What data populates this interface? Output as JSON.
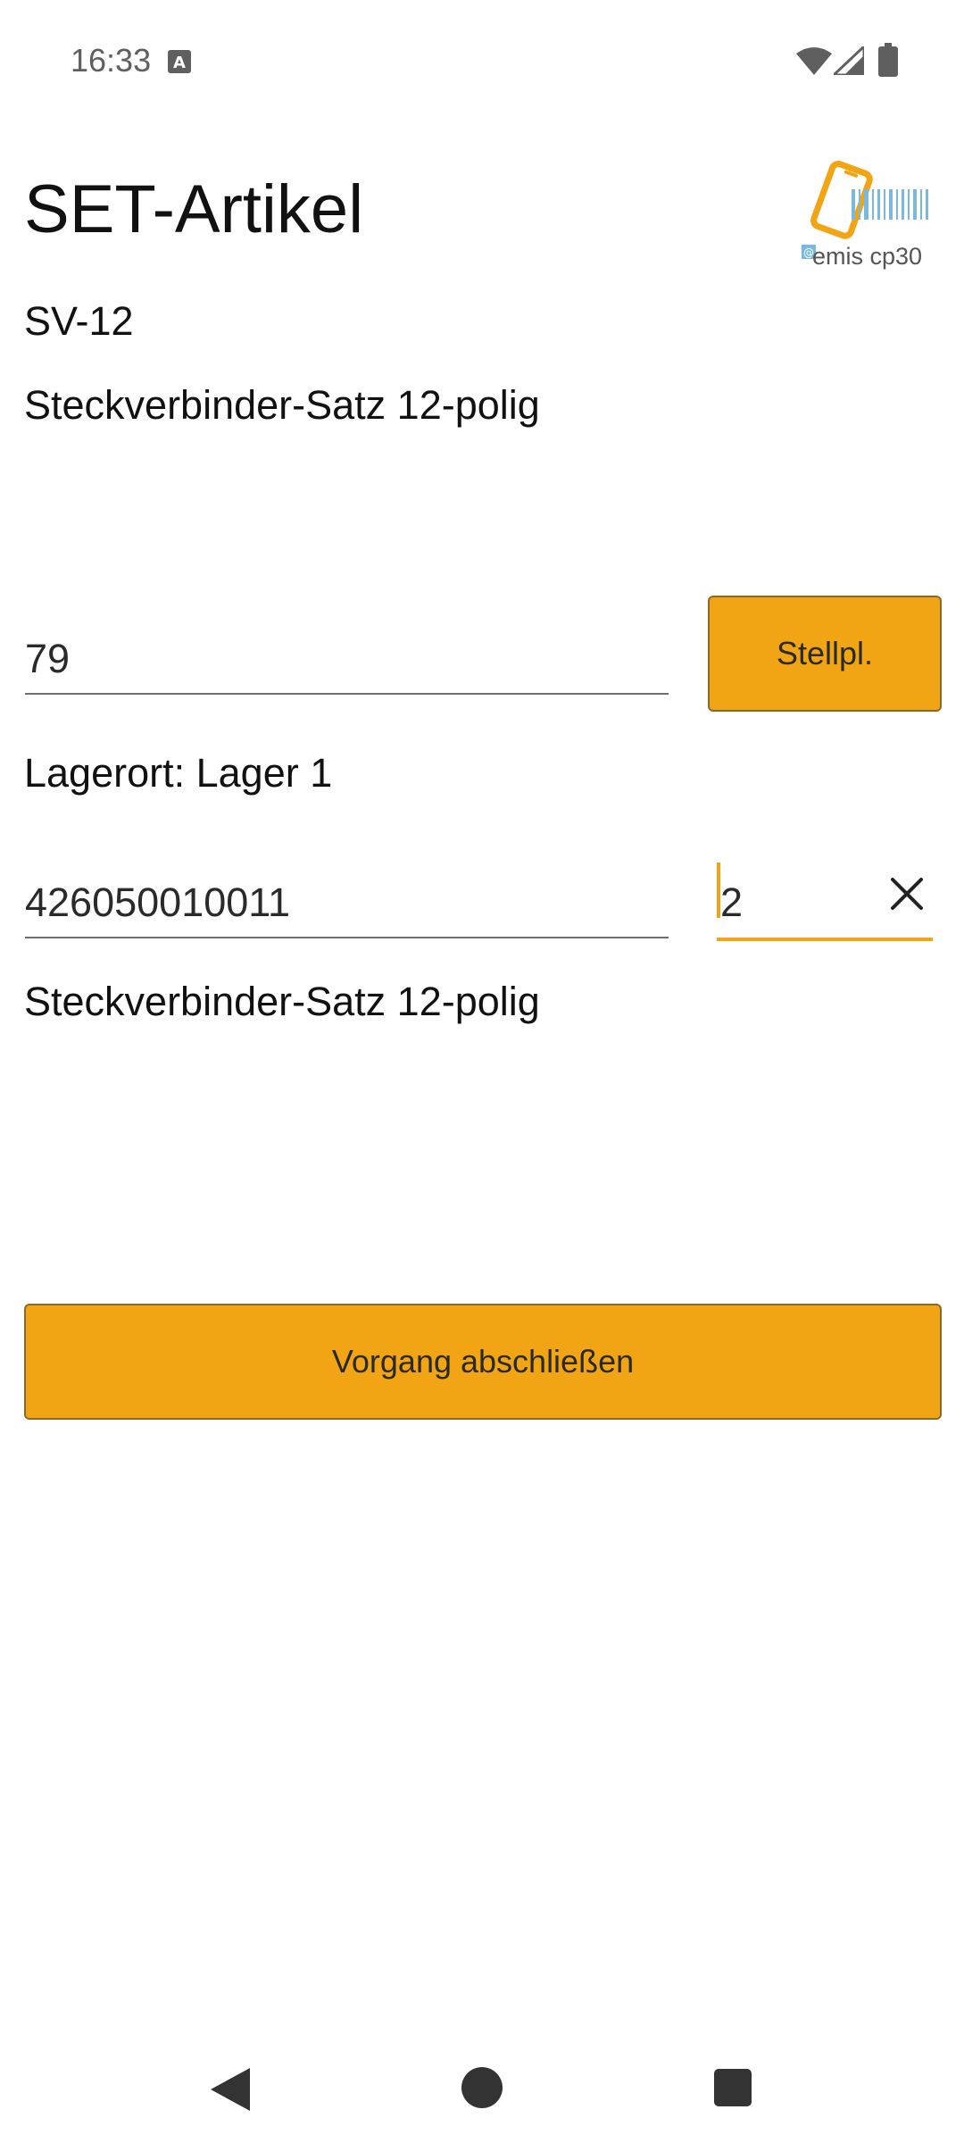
{
  "status_bar": {
    "time": "16:33",
    "icons": [
      "text-a-icon",
      "wifi-icon",
      "signal-icon",
      "battery-icon"
    ]
  },
  "header": {
    "title": "SET-Artikel",
    "logo_text": "emis cp30"
  },
  "article": {
    "number": "SV-12",
    "description": "Steckverbinder-Satz 12-polig"
  },
  "storage_place": {
    "value": "79",
    "button_label": "Stellpl."
  },
  "storage_location": "Lagerort: Lager 1",
  "barcode": {
    "value": "426050010011",
    "quantity": "2",
    "article_description": "Steckverbinder-Satz 12-polig"
  },
  "actions": {
    "complete_label": "Vorgang abschließen"
  },
  "colors": {
    "accent": "#f2a514",
    "logo_blue": "#7ab8dd"
  },
  "nav_bar": {
    "icons": [
      "back-icon",
      "home-icon",
      "recents-icon"
    ]
  }
}
